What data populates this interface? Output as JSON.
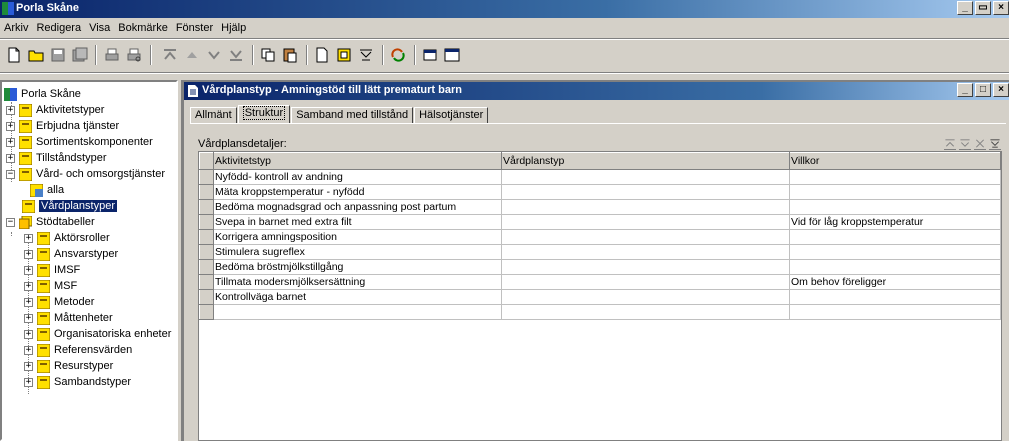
{
  "app": {
    "title": "Porla Skåne"
  },
  "menu": [
    "Arkiv",
    "Redigera",
    "Visa",
    "Bokmärke",
    "Fönster",
    "Hjälp"
  ],
  "tree": {
    "root": "Porla Skåne",
    "items": [
      "Aktivitetstyper",
      "Erbjudna tjänster",
      "Sortimentskomponenter",
      "Tillståndstyper",
      "Vård- och omsorgstjänster",
      "alla",
      "Vårdplanstyper",
      "Stödtabeller",
      "Aktörsroller",
      "Ansvarstyper",
      "IMSF",
      "MSF",
      "Metoder",
      "Måttenheter",
      "Organisatoriska enheter",
      "Referensvärden",
      "Resurstyper",
      "Sambandstyper"
    ]
  },
  "child": {
    "title": "Vårdplanstyp - Amningstöd till lätt prematurt barn",
    "tabs": [
      "Allmänt",
      "Struktur",
      "Samband med tillstånd",
      "Hälsotjänster"
    ],
    "details_label": "Vårdplansdetaljer:"
  },
  "table": {
    "columns": [
      "Aktivitetstyp",
      "Vårdplanstyp",
      "Villkor"
    ],
    "rows": [
      [
        "Nyfödd- kontroll av andning",
        "",
        ""
      ],
      [
        "Mäta kroppstemperatur - nyfödd",
        "",
        ""
      ],
      [
        "Bedöma mognadsgrad och anpassning post partum",
        "",
        ""
      ],
      [
        "Svepa in barnet med extra filt",
        "",
        "Vid för låg kroppstemperatur"
      ],
      [
        "Korrigera amningsposition",
        "",
        ""
      ],
      [
        "Stimulera sugreflex",
        "",
        ""
      ],
      [
        "Bedöma bröstmjölkstillgång",
        "",
        ""
      ],
      [
        "Tillmata modersmjölksersättning",
        "",
        "Om behov föreligger"
      ],
      [
        "Kontrollväga barnet",
        "",
        ""
      ]
    ]
  },
  "colors": {
    "title_active": "#0a246a",
    "selection": "#0a246a",
    "face": "#d4d0c8",
    "folder": "#ffe000"
  },
  "icons": [
    "new-icon",
    "open-icon",
    "save-icon",
    "save-all-icon",
    "print-icon",
    "print-preview-icon",
    "move-top-icon",
    "move-up-icon",
    "move-down-icon",
    "move-bottom-icon",
    "copy-icon",
    "paste-icon",
    "document-icon",
    "folder-doc-icon",
    "filter-icon",
    "refresh-icon",
    "window-icon",
    "cascade-icon"
  ]
}
